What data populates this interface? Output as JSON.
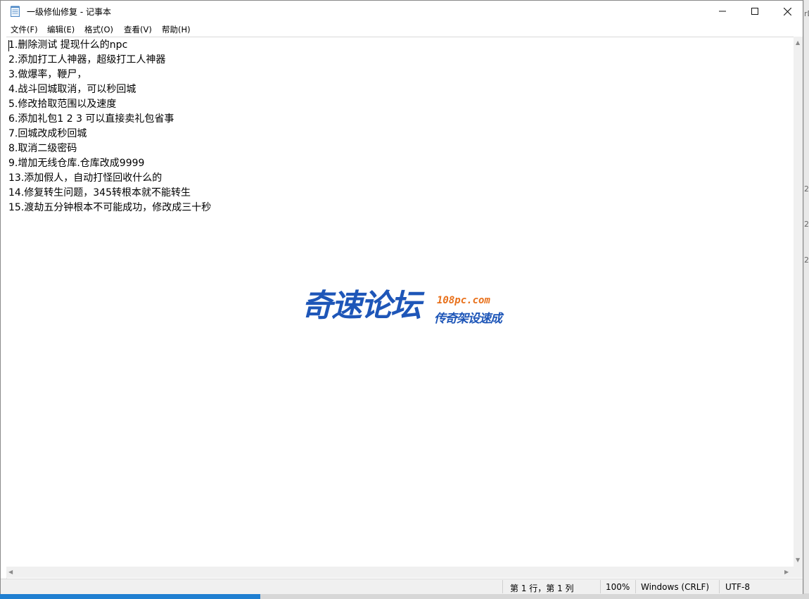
{
  "window": {
    "title": "一级修仙修复 - 记事本",
    "controls": {
      "minimize": "—",
      "maximize": "☐",
      "close": "✕"
    }
  },
  "menubar": {
    "items": [
      "文件(F)",
      "编辑(E)",
      "格式(O)",
      "查看(V)",
      "帮助(H)"
    ]
  },
  "editor": {
    "lines": [
      "1.删除测试 提现什么的npc",
      "2.添加打工人神器，超级打工人神器",
      "3.做爆率，鞭尸，",
      "4.战斗回城取消，可以秒回城",
      "5.修改拾取范围以及速度",
      "6.添加礼包1  2  3  可以直接卖礼包省事",
      "7.回城改成秒回城",
      "8.取消二级密码",
      "9.增加无线仓库.仓库改成9999",
      "13.添加假人，自动打怪回收什么的",
      "14.修复转生问题，345转根本就不能转生",
      "15.渡劫五分钟根本不可能成功，修改成三十秒"
    ]
  },
  "watermark": {
    "main": "奇速论坛",
    "url": "108pc.com",
    "sub": "传奇架设速成"
  },
  "statusbar": {
    "position": "第 1 行，第 1 列",
    "zoom": "100%",
    "line_ending": "Windows (CRLF)",
    "encoding": "UTF-8"
  },
  "desktop_edge": {
    "glyphs": [
      "rD",
      "2",
      "2",
      "2"
    ]
  }
}
